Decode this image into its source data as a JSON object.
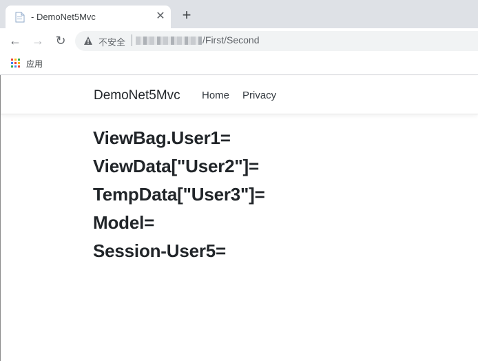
{
  "browser": {
    "tab": {
      "title": "- DemoNet5Mvc",
      "close_glyph": "✕"
    },
    "new_tab_glyph": "+",
    "nav": {
      "back_glyph": "←",
      "forward_glyph": "→",
      "reload_glyph": "↻"
    },
    "address_bar": {
      "security_label": "不安全",
      "url_path": "/First/Second"
    },
    "bookmarks": {
      "apps_label": "应用"
    }
  },
  "site": {
    "brand": "DemoNet5Mvc",
    "nav_links": [
      "Home",
      "Privacy"
    ]
  },
  "main": {
    "lines": [
      "ViewBag.User1=",
      "ViewData[\"User2\"]=",
      "TempData[\"User3\"]=",
      "Model=",
      "Session-User5="
    ]
  },
  "colors": {
    "tabstrip": "#dee1e6",
    "omnibox": "#f1f3f4",
    "text": "#212529"
  },
  "icons": {
    "favicon": "document-icon",
    "security": "warning-triangle-icon",
    "apps": "apps-grid-icon"
  }
}
